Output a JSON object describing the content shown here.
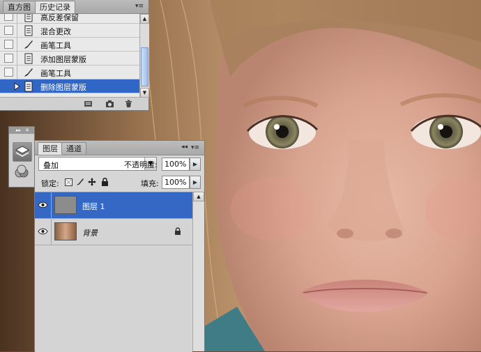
{
  "history_panel": {
    "tabs": [
      "直方图",
      "历史记录"
    ],
    "active_tab": 1,
    "items": [
      {
        "label": "高反差保留",
        "icon": "document-icon"
      },
      {
        "label": "混合更改",
        "icon": "document-icon"
      },
      {
        "label": "画笔工具",
        "icon": "brush-icon"
      },
      {
        "label": "添加图层蒙版",
        "icon": "document-icon"
      },
      {
        "label": "画笔工具",
        "icon": "brush-icon"
      },
      {
        "label": "删除图层蒙版",
        "icon": "document-icon"
      }
    ],
    "selected_index": 5
  },
  "layers_panel": {
    "tabs": [
      "图层",
      "通道"
    ],
    "active_tab": 0,
    "blend_mode": "叠加",
    "opacity_label": "不透明度:",
    "opacity_value": "100%",
    "lock_label": "锁定:",
    "fill_label": "填充:",
    "fill_value": "100%",
    "layers": [
      {
        "name": "图层 1",
        "selected": true
      },
      {
        "name": "背景",
        "selected": false,
        "locked": true
      }
    ]
  },
  "colors": {
    "selection": "#3066c6",
    "panel_bg": "#d6d6d6"
  }
}
